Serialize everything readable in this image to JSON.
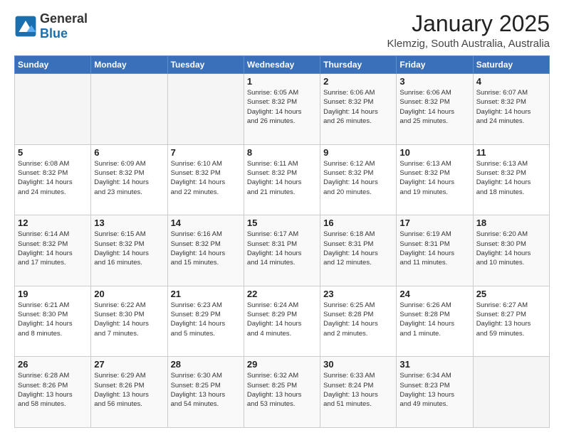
{
  "header": {
    "logo_general": "General",
    "logo_blue": "Blue",
    "month_title": "January 2025",
    "location": "Klemzig, South Australia, Australia"
  },
  "weekdays": [
    "Sunday",
    "Monday",
    "Tuesday",
    "Wednesday",
    "Thursday",
    "Friday",
    "Saturday"
  ],
  "weeks": [
    [
      {
        "day": "",
        "info": ""
      },
      {
        "day": "",
        "info": ""
      },
      {
        "day": "",
        "info": ""
      },
      {
        "day": "1",
        "info": "Sunrise: 6:05 AM\nSunset: 8:32 PM\nDaylight: 14 hours\nand 26 minutes."
      },
      {
        "day": "2",
        "info": "Sunrise: 6:06 AM\nSunset: 8:32 PM\nDaylight: 14 hours\nand 26 minutes."
      },
      {
        "day": "3",
        "info": "Sunrise: 6:06 AM\nSunset: 8:32 PM\nDaylight: 14 hours\nand 25 minutes."
      },
      {
        "day": "4",
        "info": "Sunrise: 6:07 AM\nSunset: 8:32 PM\nDaylight: 14 hours\nand 24 minutes."
      }
    ],
    [
      {
        "day": "5",
        "info": "Sunrise: 6:08 AM\nSunset: 8:32 PM\nDaylight: 14 hours\nand 24 minutes."
      },
      {
        "day": "6",
        "info": "Sunrise: 6:09 AM\nSunset: 8:32 PM\nDaylight: 14 hours\nand 23 minutes."
      },
      {
        "day": "7",
        "info": "Sunrise: 6:10 AM\nSunset: 8:32 PM\nDaylight: 14 hours\nand 22 minutes."
      },
      {
        "day": "8",
        "info": "Sunrise: 6:11 AM\nSunset: 8:32 PM\nDaylight: 14 hours\nand 21 minutes."
      },
      {
        "day": "9",
        "info": "Sunrise: 6:12 AM\nSunset: 8:32 PM\nDaylight: 14 hours\nand 20 minutes."
      },
      {
        "day": "10",
        "info": "Sunrise: 6:13 AM\nSunset: 8:32 PM\nDaylight: 14 hours\nand 19 minutes."
      },
      {
        "day": "11",
        "info": "Sunrise: 6:13 AM\nSunset: 8:32 PM\nDaylight: 14 hours\nand 18 minutes."
      }
    ],
    [
      {
        "day": "12",
        "info": "Sunrise: 6:14 AM\nSunset: 8:32 PM\nDaylight: 14 hours\nand 17 minutes."
      },
      {
        "day": "13",
        "info": "Sunrise: 6:15 AM\nSunset: 8:32 PM\nDaylight: 14 hours\nand 16 minutes."
      },
      {
        "day": "14",
        "info": "Sunrise: 6:16 AM\nSunset: 8:32 PM\nDaylight: 14 hours\nand 15 minutes."
      },
      {
        "day": "15",
        "info": "Sunrise: 6:17 AM\nSunset: 8:31 PM\nDaylight: 14 hours\nand 14 minutes."
      },
      {
        "day": "16",
        "info": "Sunrise: 6:18 AM\nSunset: 8:31 PM\nDaylight: 14 hours\nand 12 minutes."
      },
      {
        "day": "17",
        "info": "Sunrise: 6:19 AM\nSunset: 8:31 PM\nDaylight: 14 hours\nand 11 minutes."
      },
      {
        "day": "18",
        "info": "Sunrise: 6:20 AM\nSunset: 8:30 PM\nDaylight: 14 hours\nand 10 minutes."
      }
    ],
    [
      {
        "day": "19",
        "info": "Sunrise: 6:21 AM\nSunset: 8:30 PM\nDaylight: 14 hours\nand 8 minutes."
      },
      {
        "day": "20",
        "info": "Sunrise: 6:22 AM\nSunset: 8:30 PM\nDaylight: 14 hours\nand 7 minutes."
      },
      {
        "day": "21",
        "info": "Sunrise: 6:23 AM\nSunset: 8:29 PM\nDaylight: 14 hours\nand 5 minutes."
      },
      {
        "day": "22",
        "info": "Sunrise: 6:24 AM\nSunset: 8:29 PM\nDaylight: 14 hours\nand 4 minutes."
      },
      {
        "day": "23",
        "info": "Sunrise: 6:25 AM\nSunset: 8:28 PM\nDaylight: 14 hours\nand 2 minutes."
      },
      {
        "day": "24",
        "info": "Sunrise: 6:26 AM\nSunset: 8:28 PM\nDaylight: 14 hours\nand 1 minute."
      },
      {
        "day": "25",
        "info": "Sunrise: 6:27 AM\nSunset: 8:27 PM\nDaylight: 13 hours\nand 59 minutes."
      }
    ],
    [
      {
        "day": "26",
        "info": "Sunrise: 6:28 AM\nSunset: 8:26 PM\nDaylight: 13 hours\nand 58 minutes."
      },
      {
        "day": "27",
        "info": "Sunrise: 6:29 AM\nSunset: 8:26 PM\nDaylight: 13 hours\nand 56 minutes."
      },
      {
        "day": "28",
        "info": "Sunrise: 6:30 AM\nSunset: 8:25 PM\nDaylight: 13 hours\nand 54 minutes."
      },
      {
        "day": "29",
        "info": "Sunrise: 6:32 AM\nSunset: 8:25 PM\nDaylight: 13 hours\nand 53 minutes."
      },
      {
        "day": "30",
        "info": "Sunrise: 6:33 AM\nSunset: 8:24 PM\nDaylight: 13 hours\nand 51 minutes."
      },
      {
        "day": "31",
        "info": "Sunrise: 6:34 AM\nSunset: 8:23 PM\nDaylight: 13 hours\nand 49 minutes."
      },
      {
        "day": "",
        "info": ""
      }
    ]
  ]
}
